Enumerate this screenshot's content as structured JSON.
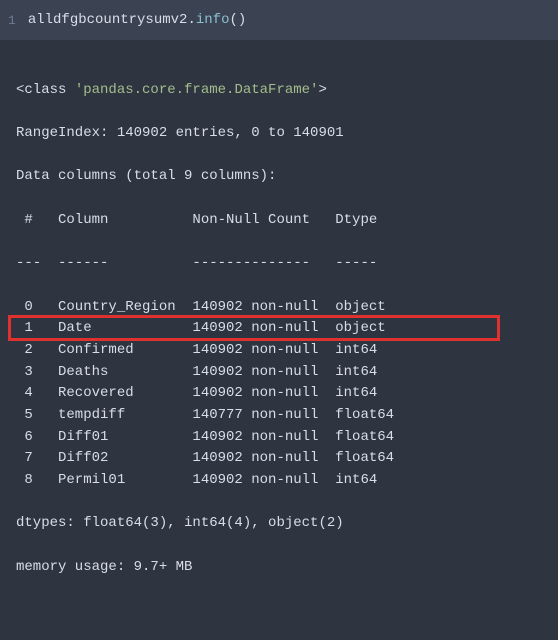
{
  "code": {
    "line_number": "1",
    "variable": "alldfgbcountrysumv2",
    "method": "info",
    "parens": "()"
  },
  "output": {
    "class_line_pre": "<class ",
    "class_str": "'pandas.core.frame.DataFrame'",
    "class_line_post": ">",
    "range_index": "RangeIndex: 140902 entries, 0 to 140901",
    "data_columns": "Data columns (total 9 columns):",
    "header": " #   Column          Non-Null Count   Dtype  ",
    "divider": "---  ------          --------------   -----  ",
    "rows": [
      " 0   Country_Region  140902 non-null  object ",
      " 1   Date            140902 non-null  object ",
      " 2   Confirmed       140902 non-null  int64  ",
      " 3   Deaths          140902 non-null  int64  ",
      " 4   Recovered       140902 non-null  int64  ",
      " 5   tempdiff        140777 non-null  float64",
      " 6   Diff01          140902 non-null  float64",
      " 7   Diff02          140902 non-null  float64",
      " 8   Permil01        140902 non-null  int64  "
    ],
    "dtypes": "dtypes: float64(3), int64(4), object(2)",
    "memory": "memory usage: 9.7+ MB"
  },
  "highlight": {
    "row_index": 1
  }
}
